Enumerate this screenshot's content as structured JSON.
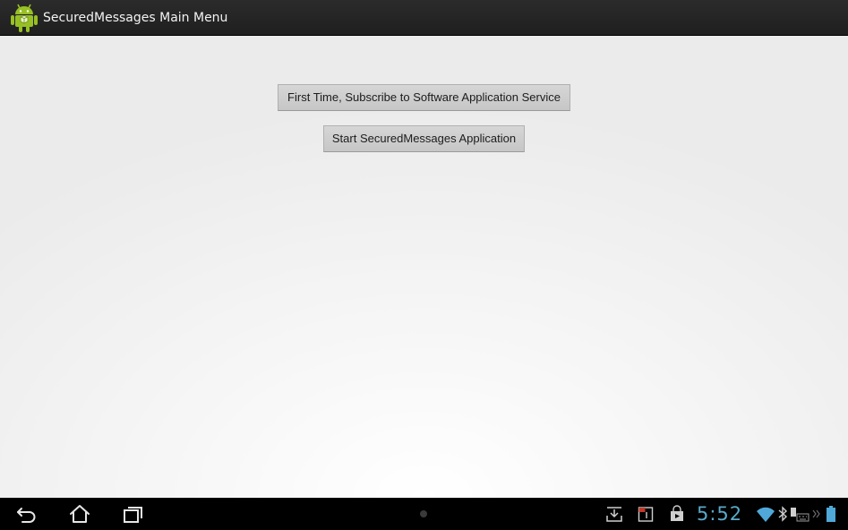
{
  "app": {
    "title": "SecuredMessages Main Menu",
    "icon": "android-robot-icon"
  },
  "main": {
    "buttons": [
      {
        "label": "First Time, Subscribe to Software Application Service"
      },
      {
        "label": "Start SecuredMessages Application"
      }
    ]
  },
  "navigation": {
    "icons": [
      "back-icon",
      "home-icon",
      "recent-apps-icon"
    ]
  },
  "status": {
    "time": "5:52",
    "icons": [
      "download-icon",
      "calendar-icon",
      "play-store-icon",
      "wifi-icon",
      "bluetooth-icon",
      "keyboard-icon",
      "battery-icon"
    ]
  },
  "colors": {
    "action_bar": "#222222",
    "content_background": "#ececec",
    "button": "#cfcfcf",
    "nav_bar": "#000000",
    "clock": "#5aa9c8",
    "android_green": "#97c024"
  }
}
